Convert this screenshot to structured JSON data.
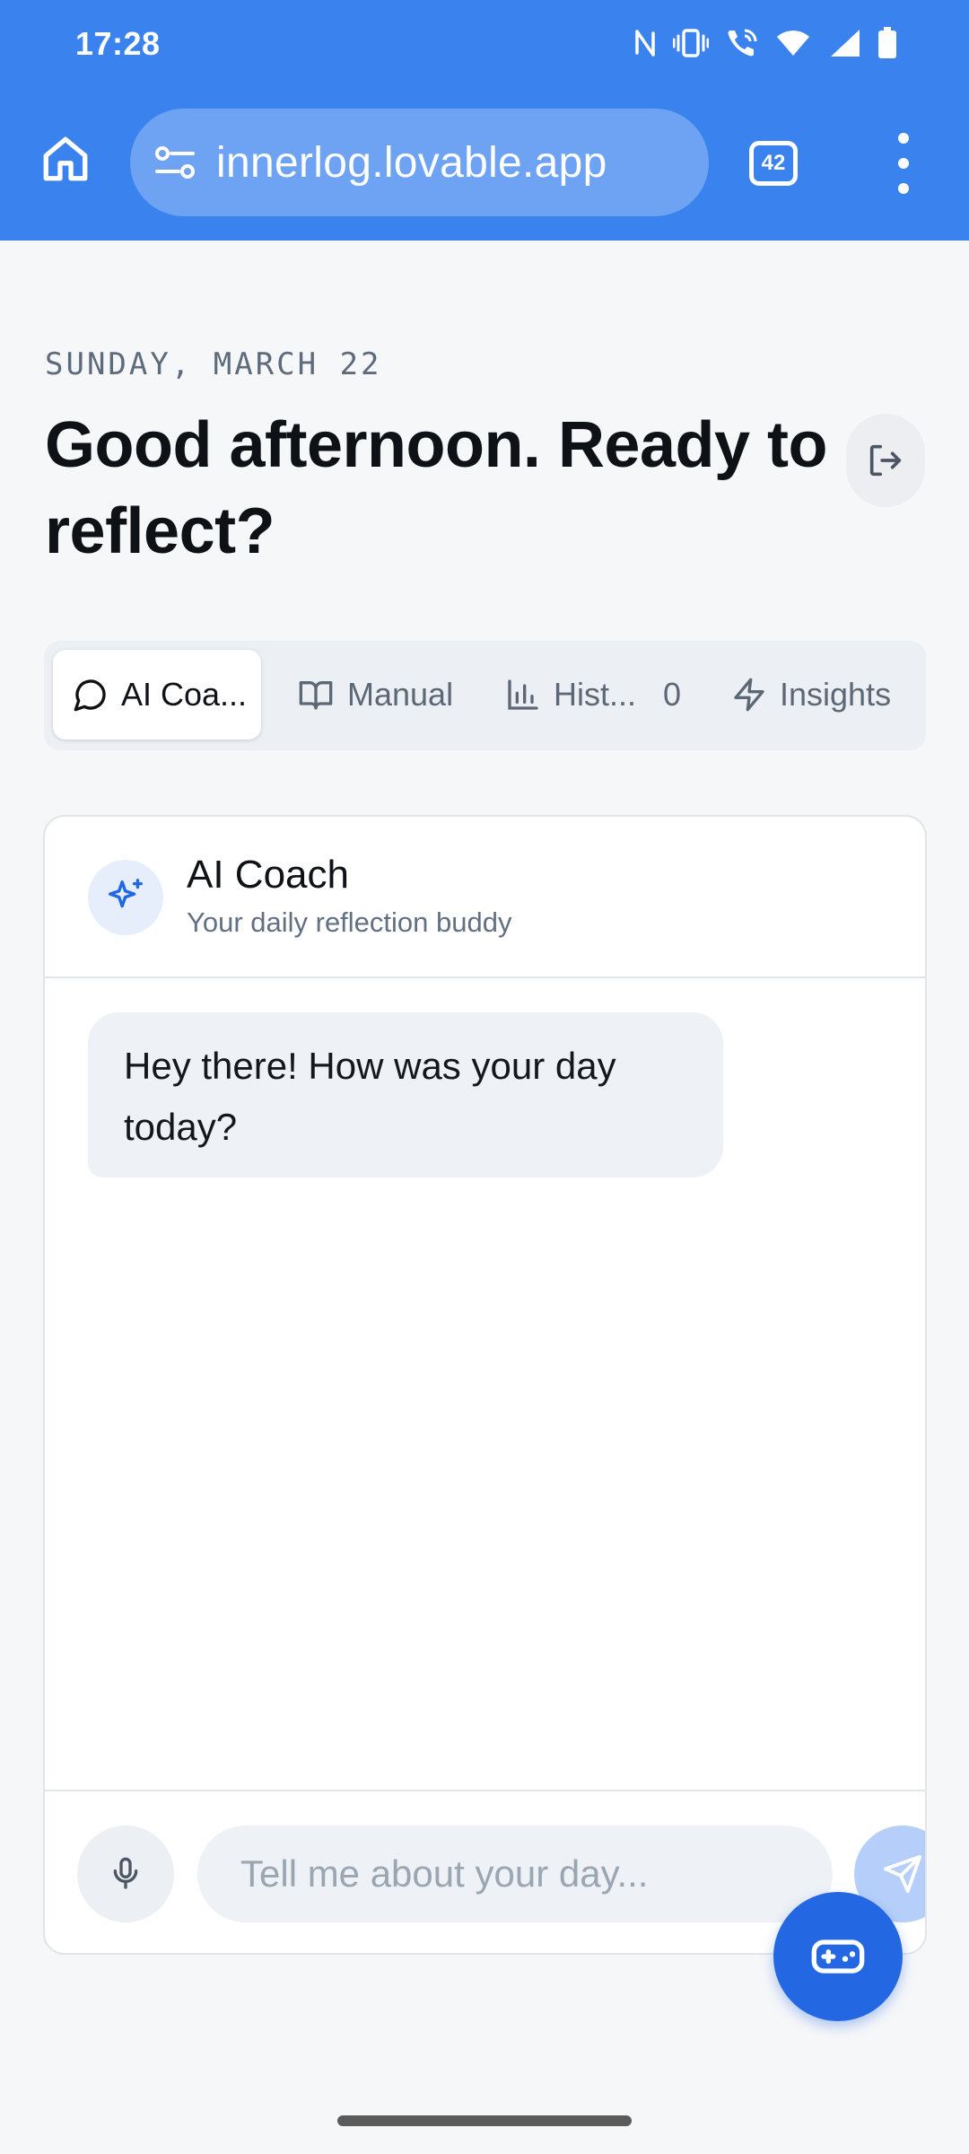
{
  "status_bar": {
    "time": "17:28",
    "icons": [
      "nfc-icon",
      "vibrate-icon",
      "wifi-call-icon",
      "wifi-icon",
      "signal-icon",
      "battery-icon"
    ]
  },
  "browser": {
    "url": "innerlog.lovable.app",
    "tab_count": "42",
    "icons": [
      "home-icon",
      "site-settings-icon",
      "tabs-icon",
      "more-vert-icon"
    ],
    "accent_color": "#3a82ee"
  },
  "header": {
    "date": "SUNDAY, MARCH 22",
    "greeting": "Good afternoon. Ready to reflect?"
  },
  "tabs": [
    {
      "label": "AI Coa...",
      "icon": "message-circle-icon",
      "active": true
    },
    {
      "label": "Manual",
      "icon": "book-open-icon",
      "active": false
    },
    {
      "label": "Hist...",
      "icon": "bar-chart-icon",
      "count": "0",
      "active": false
    },
    {
      "label": "Insights",
      "icon": "zap-icon",
      "active": false
    }
  ],
  "coach": {
    "title": "AI Coach",
    "subtitle": "Your daily reflection buddy",
    "messages": [
      {
        "from": "coach",
        "text": "Hey there! How was your day today?"
      }
    ],
    "input_placeholder": "Tell me about your day..."
  },
  "colors": {
    "primary": "#2467e3",
    "send_disabled": "#b6cffa",
    "page_background": "#f6f7f9"
  }
}
